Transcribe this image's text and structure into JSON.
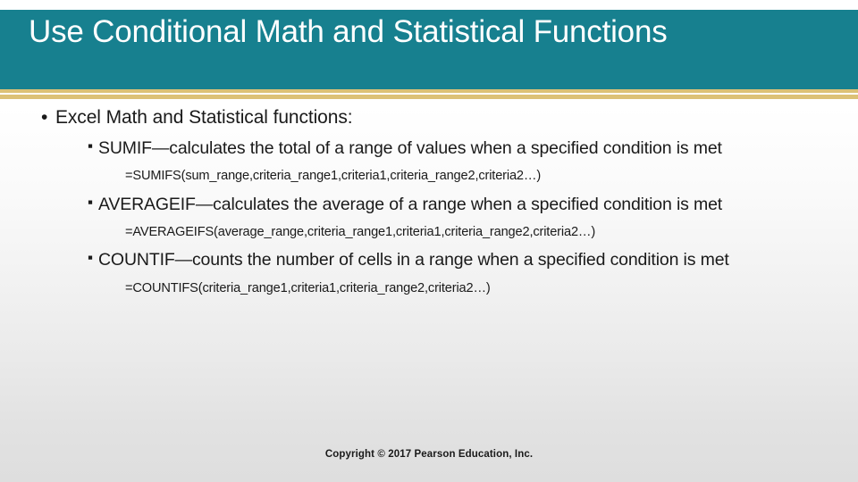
{
  "slide": {
    "title": "Use Conditional Math and Statistical Functions",
    "theme": {
      "band_color": "#17808f",
      "rule_color": "#dcc176",
      "title_text_color": "#ffffff",
      "body_text_color": "#1a1a1a"
    },
    "body": {
      "level1_bullet_glyph": "•",
      "level2_bullet_glyph": "▪",
      "intro": "Excel Math and Statistical functions:",
      "items": [
        {
          "heading": "SUMIF—calculates the total of a range of values when a specified condition is met",
          "formula": "=SUMIFS(sum_range,criteria_range1,criteria1,criteria_range2,criteria2…)"
        },
        {
          "heading": "AVERAGEIF—calculates the average of a range when a specified condition is met",
          "formula": "=AVERAGEIFS(average_range,criteria_range1,criteria1,criteria_range2,criteria2…)"
        },
        {
          "heading": "COUNTIF—counts the number of cells in a range when a specified condition is met",
          "formula": "=COUNTIFS(criteria_range1,criteria1,criteria_range2,criteria2…)"
        }
      ]
    },
    "footer": {
      "copyright": "Copyright © 2017 Pearson Education, Inc."
    }
  }
}
